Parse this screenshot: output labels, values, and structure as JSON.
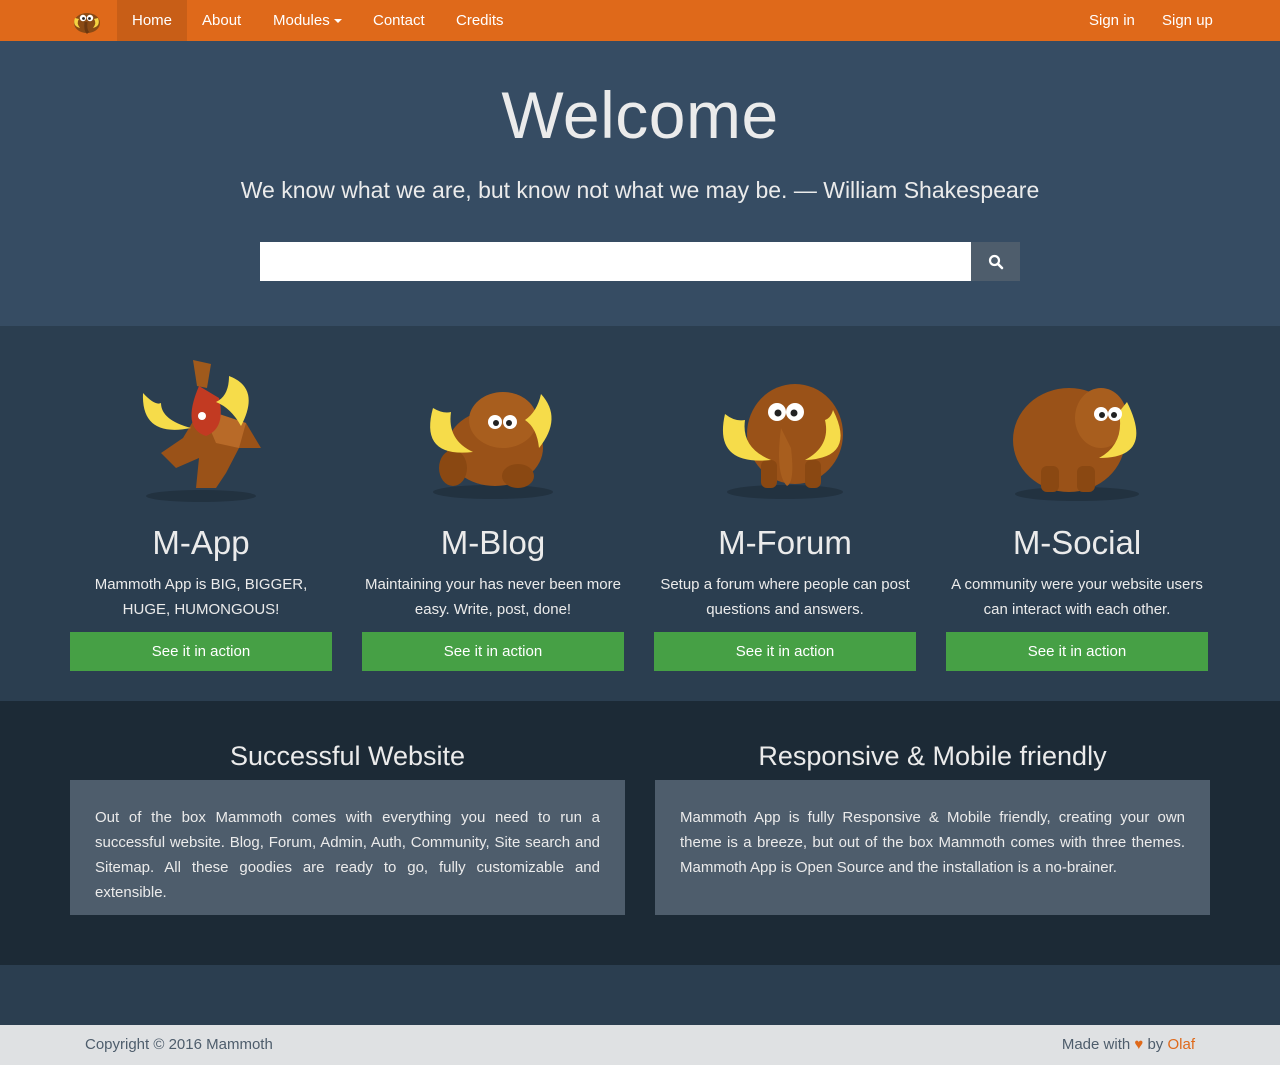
{
  "nav": {
    "items": [
      {
        "label": "Home",
        "active": true
      },
      {
        "label": "About"
      },
      {
        "label": "Modules"
      },
      {
        "label": "Contact"
      },
      {
        "label": "Credits"
      }
    ],
    "right": [
      {
        "label": "Sign in"
      },
      {
        "label": "Sign up"
      }
    ]
  },
  "hero": {
    "title": "Welcome",
    "quote": "We know what we are, but know not what we may be. — William Shakespeare",
    "search_value": ""
  },
  "modules": [
    {
      "title": "M-App",
      "desc": "Mammoth App is BIG, BIGGER, HUGE, HUMONGOUS!",
      "button": "See it in action",
      "icon": "mammoth-app-icon"
    },
    {
      "title": "M-Blog",
      "desc": "Maintaining your has never been more easy. Write, post, done!",
      "button": "See it in action",
      "icon": "mammoth-blog-icon"
    },
    {
      "title": "M-Forum",
      "desc": "Setup a forum where people can post questions and answers.",
      "button": "See it in action",
      "icon": "mammoth-forum-icon"
    },
    {
      "title": "M-Social",
      "desc": "A community were your website users can interact with each other.",
      "button": "See it in action",
      "icon": "mammoth-social-icon"
    }
  ],
  "features": [
    {
      "title": "Successful Website",
      "text": "Out of the box Mammoth comes with everything you need to run a successful website. Blog, Forum, Admin, Auth, Community, Site search and Sitemap. All these goodies are ready to go, fully customizable and extensible."
    },
    {
      "title": "Responsive & Mobile friendly",
      "text": "Mammoth App is fully Responsive & Mobile friendly, creating your own theme is a breeze, but out of the box Mammoth comes with three themes. Mammoth App is Open Source and the installation is a no-brainer."
    }
  ],
  "footer": {
    "copyright": "Copyright © 2016 Mammoth",
    "made_with": "Made with",
    "heart": "♥",
    "by": "by",
    "author": "Olaf"
  },
  "colors": {
    "brand": "#df691a",
    "success": "#46a045",
    "hero_bg": "#364c63",
    "body_bg": "#2b3e50",
    "features_bg": "#1c2a36"
  }
}
